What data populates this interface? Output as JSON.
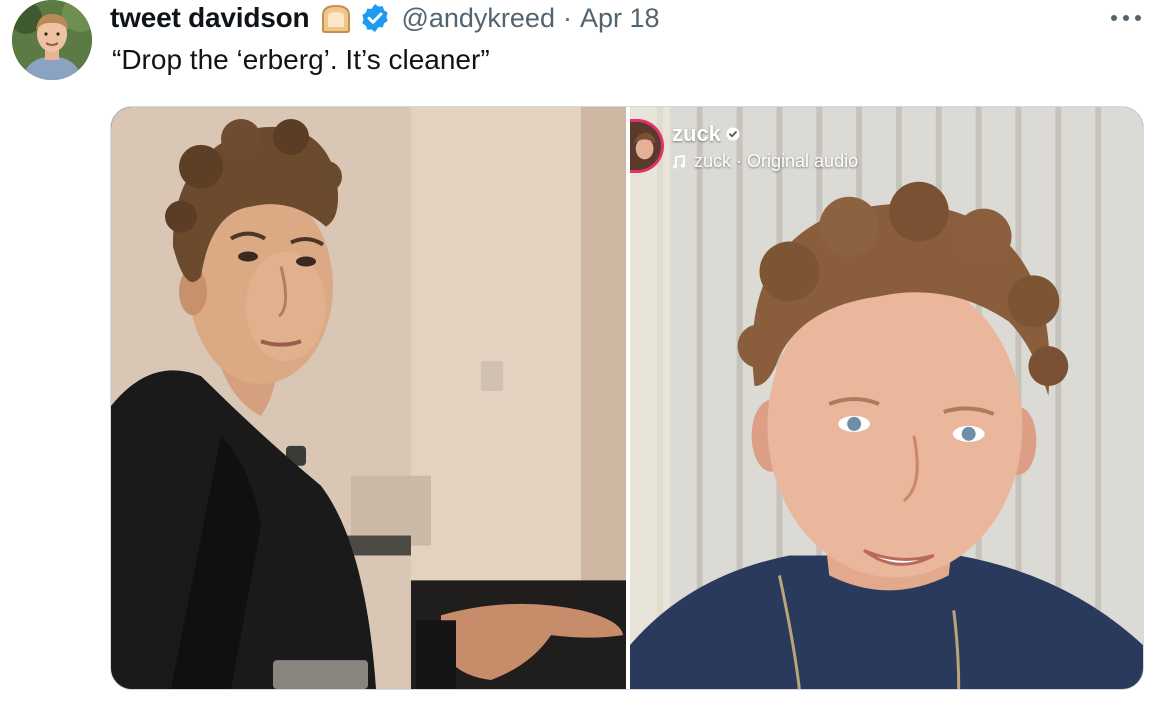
{
  "author": {
    "display_name": "tweet davidson",
    "emoji": "bread-emoji",
    "verified": "verified-badge-icon",
    "handle": "@andykreed",
    "separator": "·",
    "date": "Apr 18"
  },
  "tweet": {
    "text": "“Drop the ‘erberg’. It’s cleaner”"
  },
  "media": {
    "left_photo": "photo-man-dark-jacket",
    "right_photo": "photo-curly-hair-man-selfie",
    "overlay": {
      "username": "zuck",
      "audio_user": "zuck",
      "separator": "·",
      "audio_label": "Original audio"
    }
  },
  "colors": {
    "text_primary": "#0f1419",
    "text_secondary": "#536471",
    "verified_blue": "#1d9bf0",
    "border": "#cfd9de"
  },
  "icons": {
    "more": "more-horizontal-icon",
    "music": "music-note-icon",
    "overlay_badge": "verified-check-icon"
  }
}
